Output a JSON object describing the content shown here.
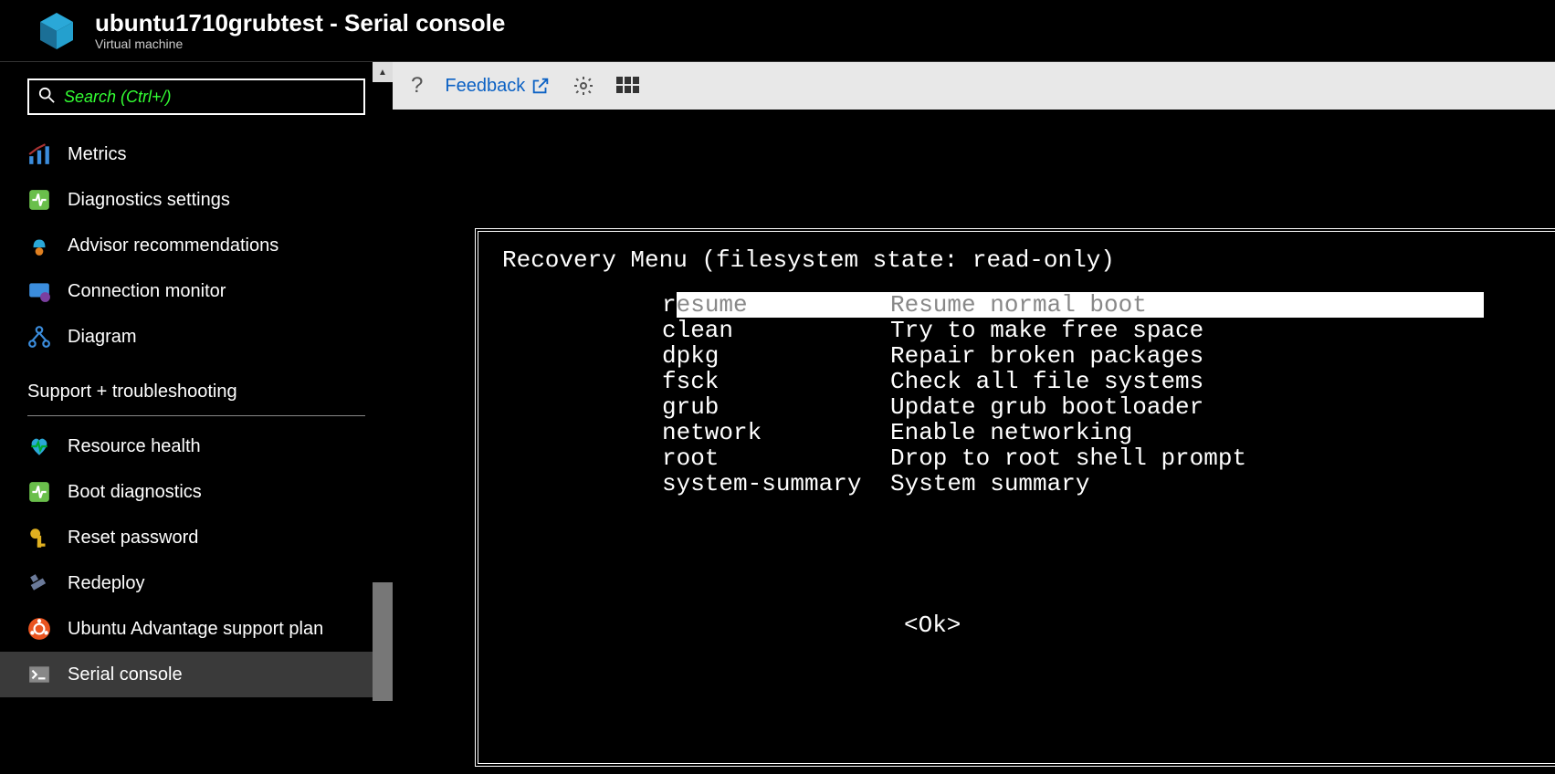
{
  "header": {
    "title": "ubuntu1710grubtest - Serial console",
    "subtitle": "Virtual machine"
  },
  "search": {
    "placeholder": "Search (Ctrl+/)"
  },
  "nav": {
    "items": [
      {
        "label": "Metrics"
      },
      {
        "label": "Diagnostics settings"
      },
      {
        "label": "Advisor recommendations"
      },
      {
        "label": "Connection monitor"
      },
      {
        "label": "Diagram"
      }
    ],
    "section_title": "Support + troubleshooting",
    "support_items": [
      {
        "label": "Resource health"
      },
      {
        "label": "Boot diagnostics"
      },
      {
        "label": "Reset password"
      },
      {
        "label": "Redeploy"
      },
      {
        "label": "Ubuntu Advantage support plan"
      },
      {
        "label": "Serial console"
      }
    ]
  },
  "toolbar": {
    "help": "?",
    "feedback": "Feedback"
  },
  "console": {
    "title": "Recovery Menu (filesystem state: read-only)",
    "items": [
      {
        "key": "resume",
        "desc": "Resume normal boot",
        "selected": true
      },
      {
        "key": "clean",
        "desc": "Try to make free space",
        "selected": false
      },
      {
        "key": "dpkg",
        "desc": "Repair broken packages",
        "selected": false
      },
      {
        "key": "fsck",
        "desc": "Check all file systems",
        "selected": false
      },
      {
        "key": "grub",
        "desc": "Update grub bootloader",
        "selected": false
      },
      {
        "key": "network",
        "desc": "Enable networking",
        "selected": false
      },
      {
        "key": "root",
        "desc": "Drop to root shell prompt",
        "selected": false
      },
      {
        "key": "system-summary",
        "desc": "System summary",
        "selected": false
      }
    ],
    "ok": "<Ok>"
  }
}
